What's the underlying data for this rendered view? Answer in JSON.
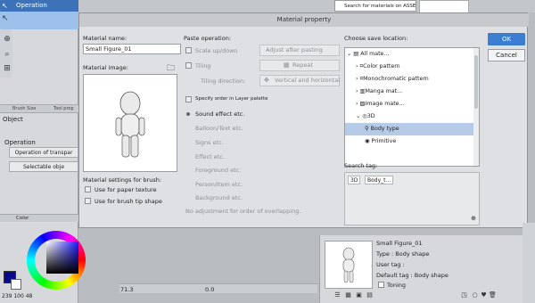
{
  "left_panel": {
    "header": "Operation",
    "subtabs": [
      "Brush Size",
      "Tool prop"
    ],
    "object_label": "Object",
    "operation_label": "Operation",
    "operation_buttons": [
      "Operation of transpar",
      "Selectable obje"
    ],
    "color_tab": "Color",
    "hsv_readout": "239 100 48"
  },
  "top": {
    "search_placeholder": "Search for materials on ASSE"
  },
  "dialog": {
    "title": "Material property",
    "material_name_label": "Material name:",
    "material_name_value": "Small Figure_01",
    "material_image_label": "Material image:",
    "brush_settings_label": "Material settings for brush:",
    "use_paper_texture": "Use for paper texture",
    "use_brush_tip": "Use for brush tip shape",
    "paste_operation_label": "Paste operation:",
    "scale_label": "Scale up/down",
    "scale_value": "Adjust after pasting",
    "tiling_label": "Tiling",
    "tiling_value": "Repeat",
    "tiling_direction_label": "Tiling direction:",
    "tiling_direction_value": "Vertical and horizontal",
    "specify_order": "Specify order in Layer palette",
    "order_items": [
      "Sound effect etc.",
      "Balloon/Text etc.",
      "Signs etc.",
      "Effect etc.",
      "Foreground etc.",
      "Person/Item etc.",
      "Background etc."
    ],
    "no_adjust": "No adjustment for order of overlapping.",
    "save_location_label": "Choose save location:",
    "tree": [
      "All mate...",
      "Color pattern",
      "Monochromatic pattern",
      "Manga mat...",
      "Image mate...",
      "3D",
      "Body type",
      "Primitive"
    ],
    "search_tag_label": "Search tag:",
    "tags": [
      "3D",
      "Body_t..."
    ],
    "ok": "OK",
    "cancel": "Cancel"
  },
  "bottom": {
    "zoom": "71.3",
    "angle": "0.0",
    "info_name": "Small Figure_01",
    "info_type": "Type : Body shape",
    "info_user_tag": "User tag :",
    "info_default_tag": "Default tag : Body shape",
    "toning": "Toning"
  },
  "colors": {
    "accent": "#3c7ed2",
    "selection": "#b5cbe8",
    "foreground_swatch": "#0a0b8c"
  }
}
